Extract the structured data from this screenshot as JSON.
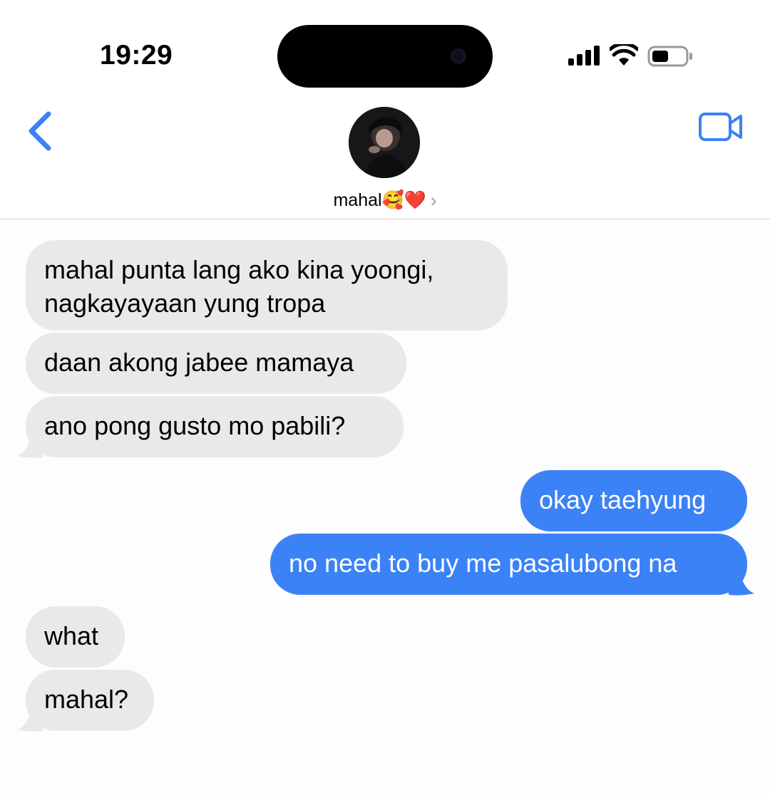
{
  "status_bar": {
    "time": "19:29",
    "icons": [
      "cellular-signal-icon",
      "wifi-icon",
      "battery-icon"
    ]
  },
  "nav": {
    "back_icon": "chevron-left-icon",
    "video_icon": "video-camera-icon",
    "contact_name": "mahal🥰❤️",
    "contact_chevron": "›",
    "accent_color": "#3b82f6"
  },
  "messages": [
    {
      "direction": "incoming",
      "lines": [
        "mahal punta lang ako kina yoongi,",
        "nagkayayaan yung tropa"
      ]
    },
    {
      "direction": "incoming",
      "text": "daan akong jabee mamaya"
    },
    {
      "direction": "incoming",
      "text": "ano pong gusto mo pabili?"
    },
    {
      "direction": "outgoing",
      "text": "okay taehyung"
    },
    {
      "direction": "outgoing",
      "text": "no need to buy me pasalubong na"
    },
    {
      "direction": "incoming",
      "text": "what"
    },
    {
      "direction": "incoming",
      "text": "mahal?"
    }
  ],
  "colors": {
    "incoming_bubble": "#e9e9eb",
    "outgoing_bubble": "#3b82f6",
    "background": "#fdfdfd"
  }
}
